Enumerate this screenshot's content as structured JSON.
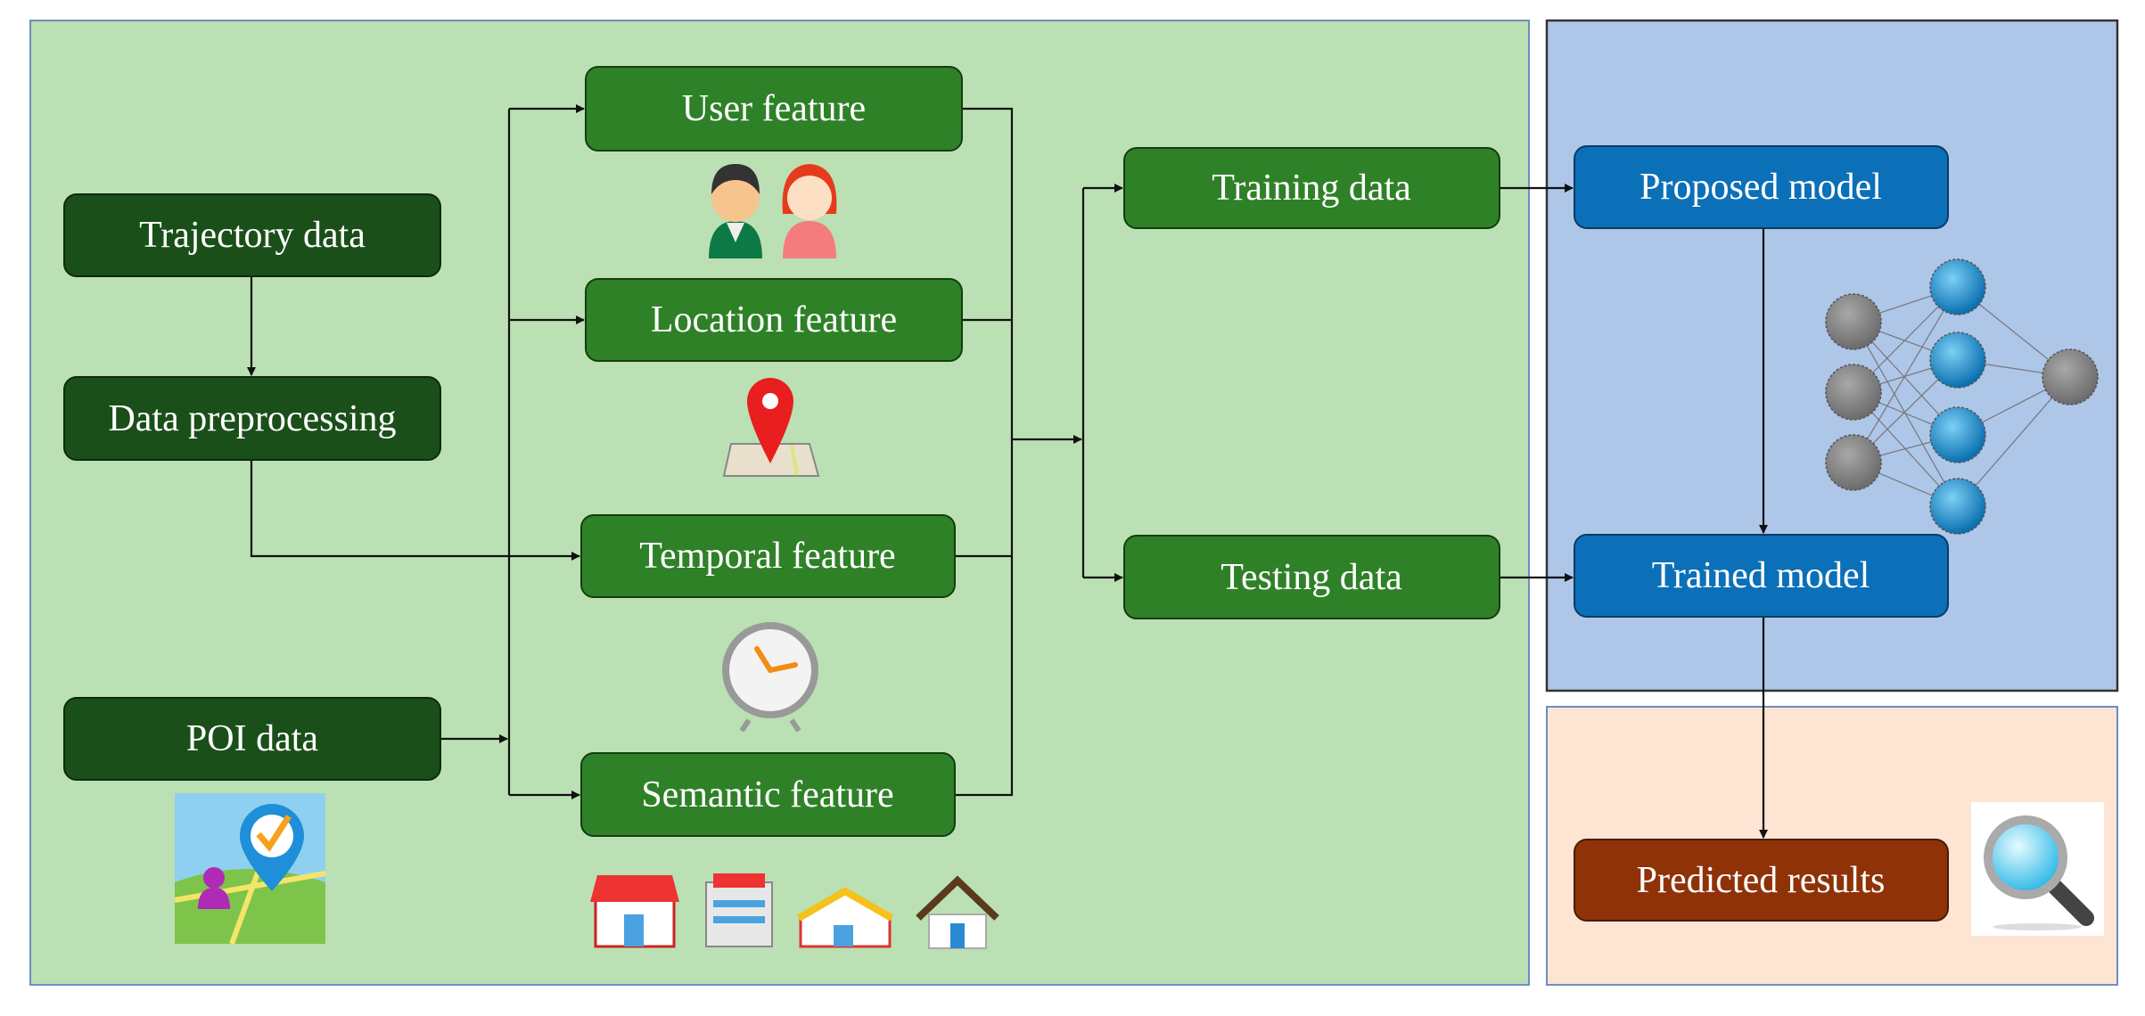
{
  "colors": {
    "data_panel": "#bbe0b3",
    "model_panel": "#aec6e8",
    "result_panel": "#fde4d3",
    "input_box": "#1b4f1a",
    "feature_box": "#2f8128",
    "model_box": "#0b70b8",
    "result_box": "#8f3208"
  },
  "inputs": {
    "trajectory": "Trajectory data",
    "preprocessing": "Data preprocessing",
    "poi": "POI data"
  },
  "features": {
    "user": "User feature",
    "location": "Location feature",
    "temporal": "Temporal feature",
    "semantic": "Semantic feature"
  },
  "datasets": {
    "training": "Training data",
    "testing": "Testing data"
  },
  "models": {
    "proposed": "Proposed model",
    "trained": "Trained model"
  },
  "results": {
    "predicted": "Predicted results"
  },
  "icons": [
    "users-icon",
    "map-pin-icon",
    "clock-icon",
    "poi-check-icon",
    "store-icons",
    "neural-network-icon",
    "magnifier-icon"
  ]
}
